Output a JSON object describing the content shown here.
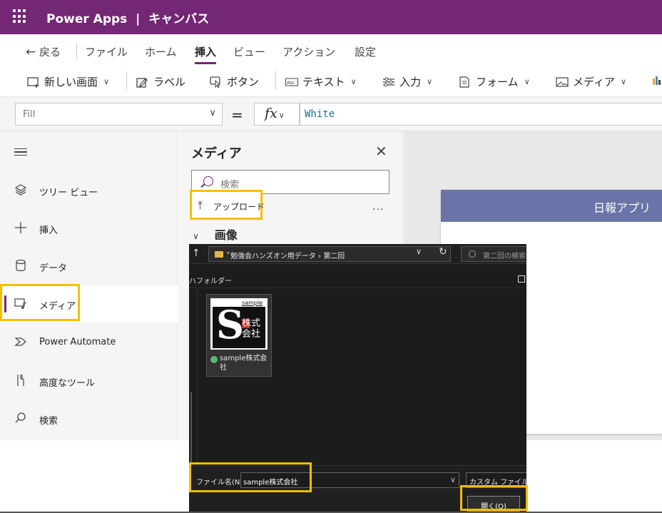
{
  "titlebar": {
    "app_name": "Power Apps",
    "separator": "|",
    "mode": "キャンバス",
    "background": "#742774"
  },
  "menu": {
    "back": "戻る",
    "items": [
      "ファイル",
      "ホーム",
      "挿入",
      "ビュー",
      "アクション",
      "設定"
    ],
    "active": "挿入"
  },
  "toolbar": {
    "new_screen": "新しい画面",
    "label": "ラベル",
    "button": "ボタン",
    "text": "テキスト",
    "input": "入力",
    "form": "フォーム",
    "media": "メディア"
  },
  "formula": {
    "property": "Fill",
    "equals": "=",
    "fx": "fx",
    "value": "White"
  },
  "leftnav": {
    "items": [
      {
        "label": "ツリー ビュー",
        "icon": "layers-icon"
      },
      {
        "label": "挿入",
        "icon": "plus-icon"
      },
      {
        "label": "データ",
        "icon": "database-icon"
      },
      {
        "label": "メディア",
        "icon": "media-icon",
        "active": true
      },
      {
        "label": "Power Automate",
        "icon": "power-automate-icon"
      },
      {
        "label": "高度なツール",
        "icon": "tools-icon"
      },
      {
        "label": "検索",
        "icon": "search-icon"
      }
    ]
  },
  "media_panel": {
    "title": "メディア",
    "search_placeholder": "検索",
    "upload": "アップロード",
    "more": "...",
    "section": "画像"
  },
  "canvas": {
    "app_header": "日報アプリ",
    "header_color": "#6b74a8"
  },
  "file_dialog": {
    "path_prefix": "«",
    "path_folder1": "勉強会ハンズオン用データ",
    "path_sep": "›",
    "path_folder2": "第二回",
    "search_placeholder": "第二回の検索",
    "new_folder": "ハフォルダー",
    "file": {
      "name": "sample株式会社",
      "thumb_text_small": "sample",
      "thumb_letter": "S",
      "thumb_kanji": "株式会社"
    },
    "filename_label": "ファイル名(N):",
    "filename_value": "sample株式会社",
    "filter": "カスタム ファイル",
    "open_button": "開く(O)"
  },
  "highlight_color": "#f5bf00"
}
